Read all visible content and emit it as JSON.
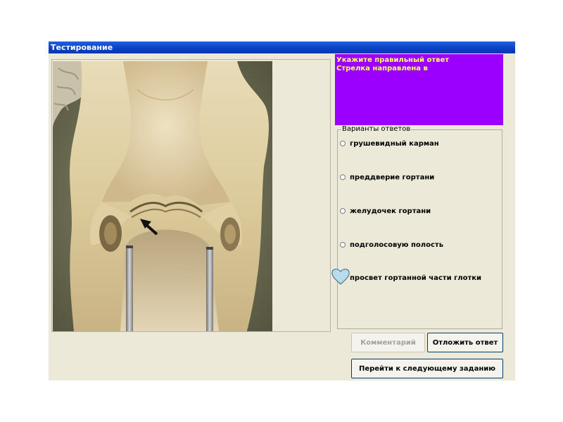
{
  "window": {
    "title": "Тестирование"
  },
  "question": {
    "line1": "Укажите правильный ответ",
    "line2": "Стрелка направлена в"
  },
  "answers": {
    "legend": "Варианты ответов",
    "options": [
      {
        "label": "грушевидный карман",
        "selected": false
      },
      {
        "label": "преддверие гортани",
        "selected": false
      },
      {
        "label": "желудочек гортани",
        "selected": false
      },
      {
        "label": "подголосовую полость",
        "selected": false
      },
      {
        "label": "просвет гортанной части глотки",
        "selected": false
      }
    ]
  },
  "buttons": {
    "comment": {
      "label": "Комментарий",
      "enabled": false
    },
    "postpone": {
      "label": "Отложить ответ",
      "enabled": true
    },
    "next": {
      "label": "Перейти к следующему заданию",
      "enabled": true
    }
  },
  "colors": {
    "title_bar": "#0a3fc4",
    "question_bg": "#9b00ff",
    "question_text": "#ffff66",
    "window_bg": "#ece9d8"
  },
  "cursor": {
    "icon": "heart-cursor-icon"
  }
}
